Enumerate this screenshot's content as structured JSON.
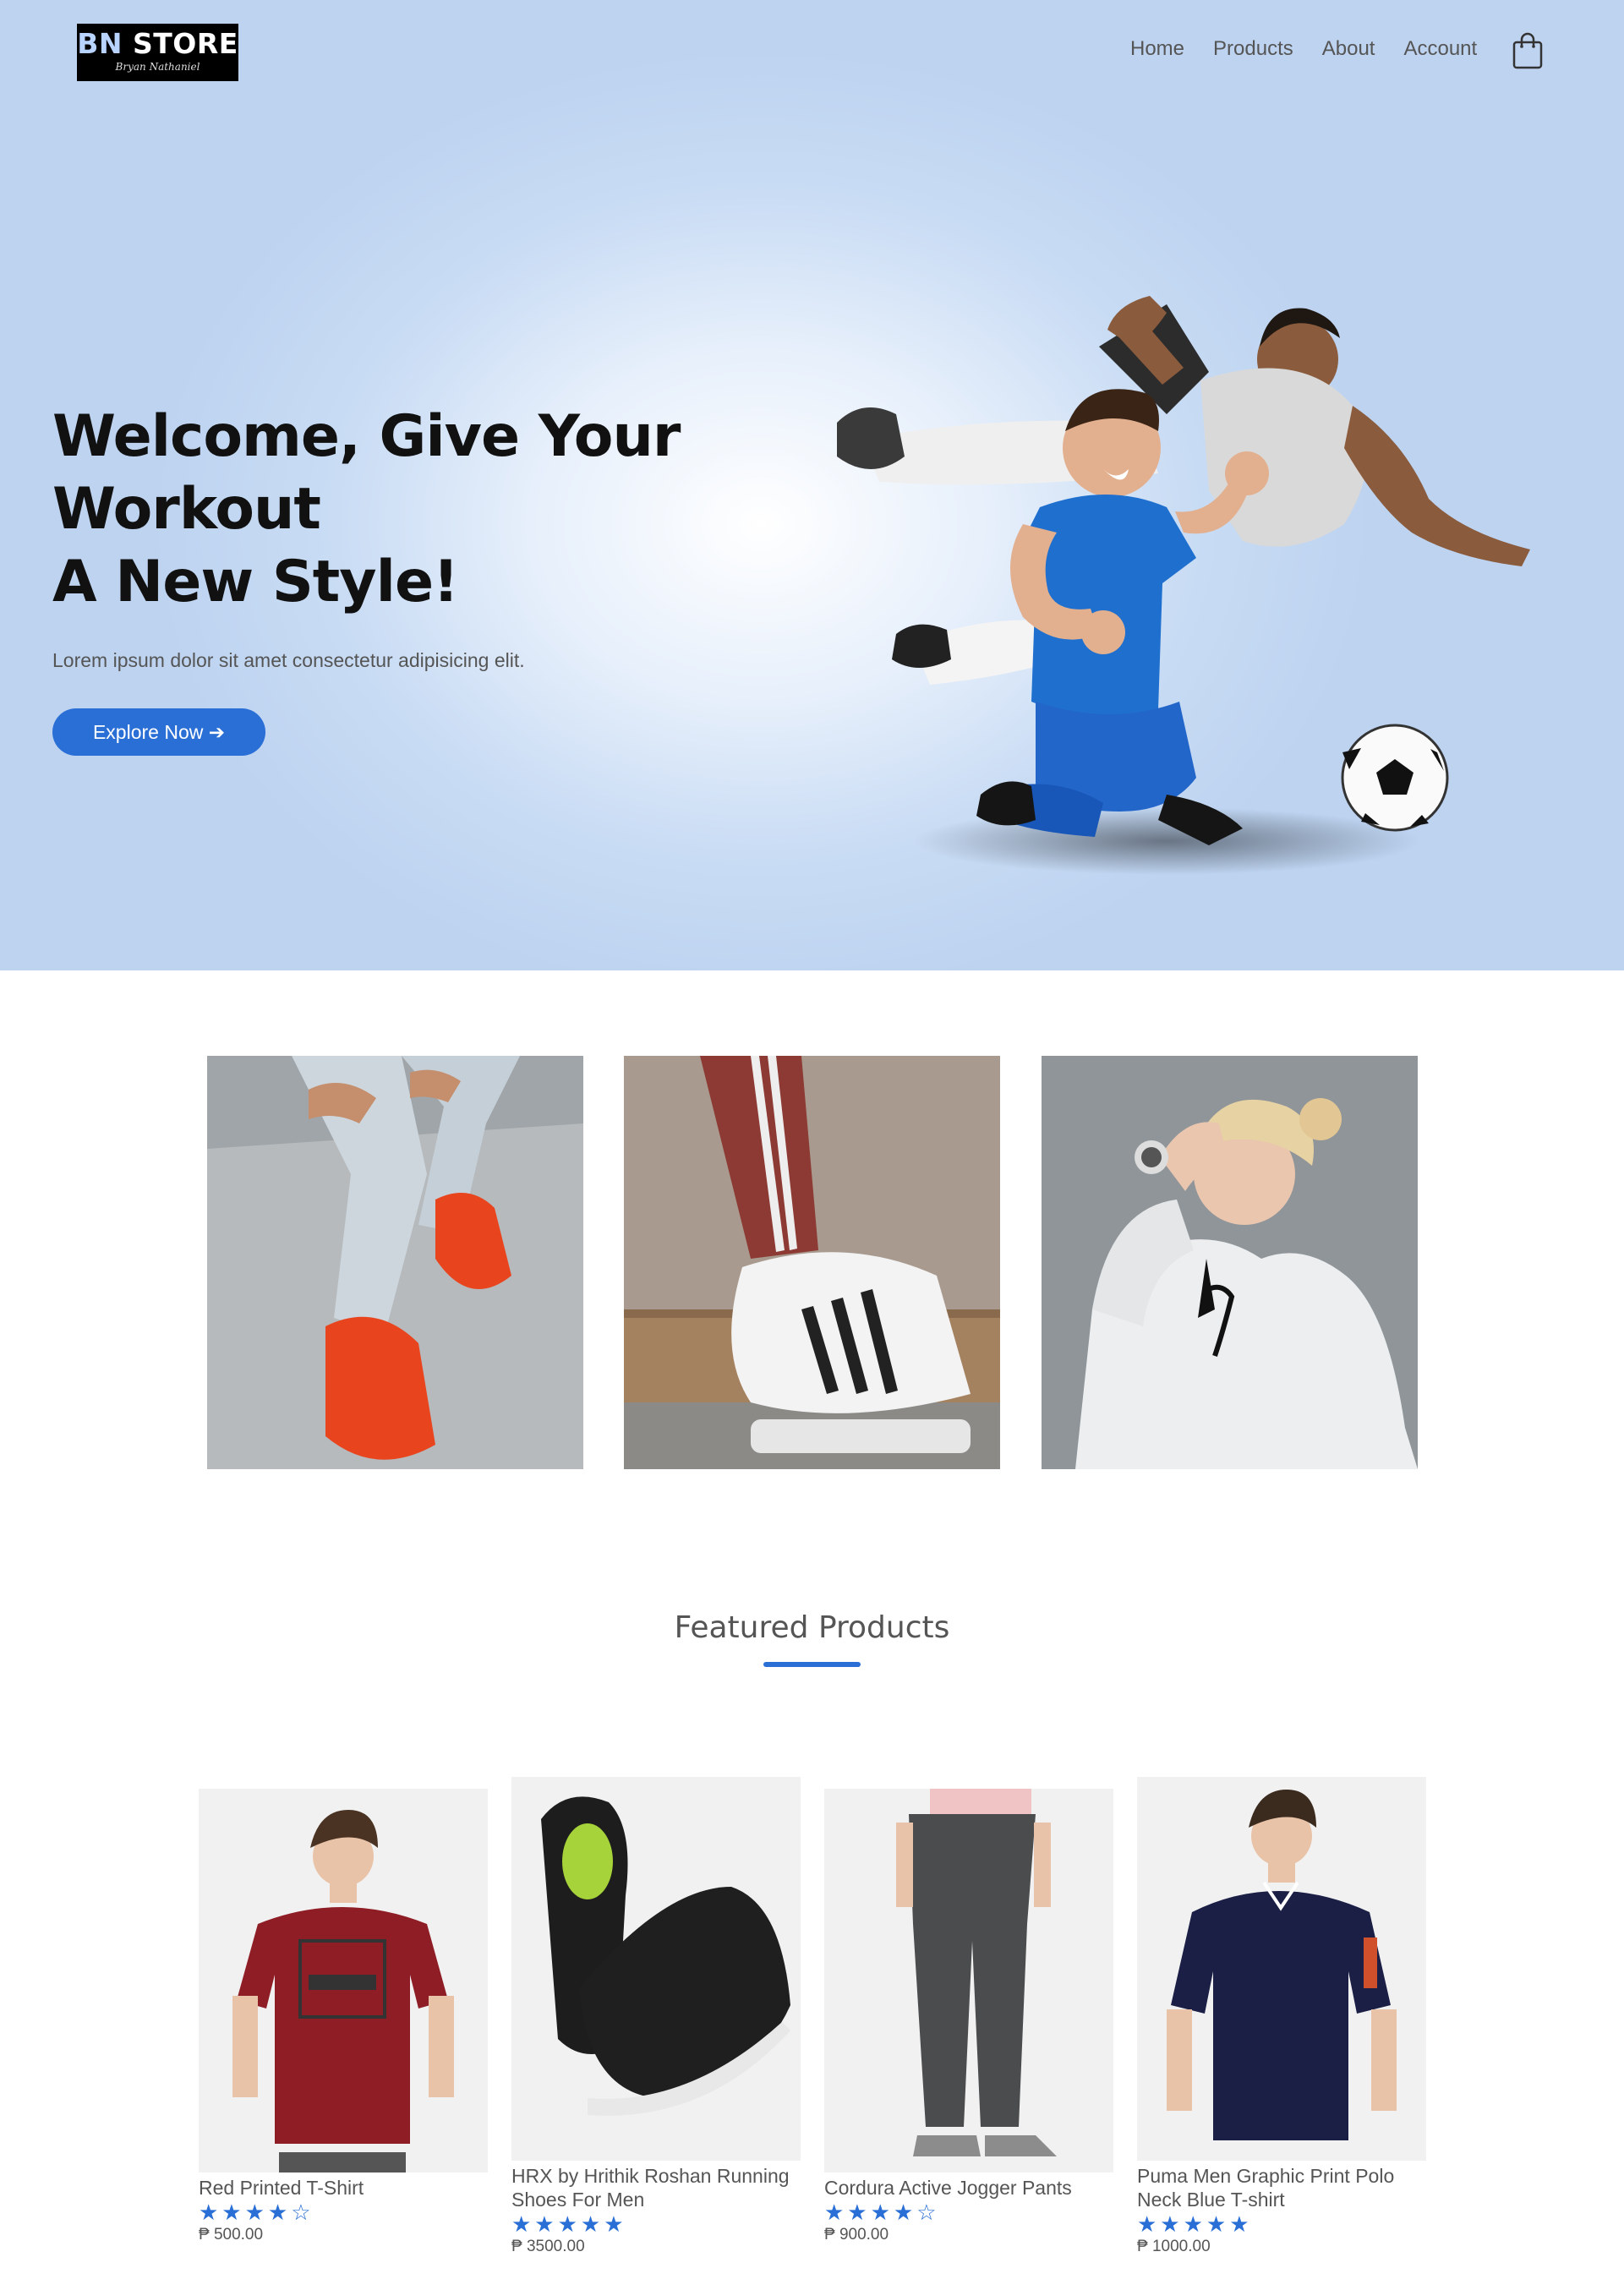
{
  "brand": {
    "name_part1": "BN",
    "name_part2": " STORE",
    "subtitle": "Bryan Nathaniel"
  },
  "nav": {
    "items": [
      "Home",
      "Products",
      "About",
      "Account"
    ],
    "cart_icon": "shopping-bag-icon"
  },
  "hero": {
    "headline_line1": "Welcome, Give Your",
    "headline_line2": "Workout",
    "headline_line3": "A New Style!",
    "lead": "Lorem ipsum dolor sit amet consectetur adipisicing elit.",
    "cta_label": "Explore Now ➔"
  },
  "featured": {
    "title": "Featured Products",
    "accent_color": "#2a6fd6",
    "products": [
      {
        "name": "Red Printed T-Shirt",
        "stars": "★★★★☆",
        "rating": 4,
        "price": "₱ 500.00"
      },
      {
        "name": "HRX by Hrithik Roshan Running Shoes For Men",
        "stars": "★★★★★",
        "rating": 5,
        "price": "₱ 3500.00"
      },
      {
        "name": "Cordura Active Jogger Pants",
        "stars": "★★★★☆",
        "rating": 4,
        "price": "₱ 900.00"
      },
      {
        "name": "Puma Men Graphic Print Polo Neck Blue T-shirt",
        "stars": "★★★★★",
        "rating": 5,
        "price": "₱ 1000.00"
      }
    ]
  }
}
